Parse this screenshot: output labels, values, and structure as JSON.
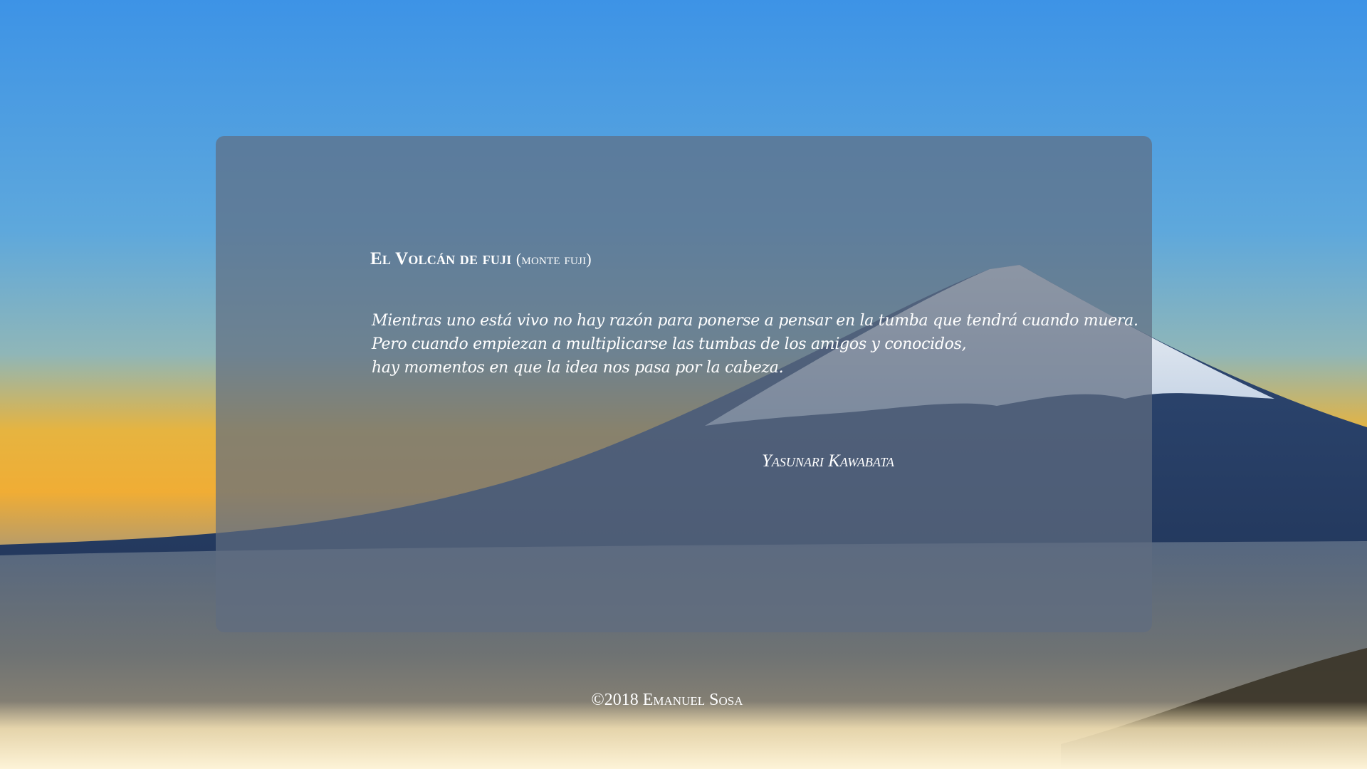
{
  "page": {
    "background_icon": "mount-fuji-landscape-photo",
    "colors": {
      "sky_top": "#4a9be8",
      "sky_horizon": "#f2b23a",
      "card_overlay": "#606c80",
      "text": "#ffffff"
    }
  },
  "card": {
    "title": "El Volcán de fuji",
    "title_sub": "(monte fuji)",
    "poem_lines": [
      "Mientras uno está vivo no hay razón para ponerse a pensar en la tumba que tendrá cuando muera.",
      "Pero cuando empiezan a multiplicarse las tumbas de los amigos y conocidos,",
      "hay momentos en que la idea nos pasa por la cabeza."
    ],
    "author": "Yasunari Kawabata"
  },
  "footer": {
    "copyright": "©2018 Emanuel Sosa"
  }
}
